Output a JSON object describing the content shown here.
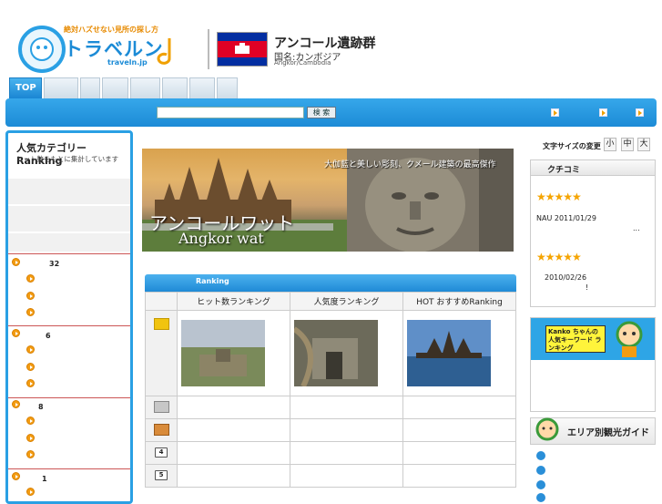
{
  "header": {
    "logo_tagline": "絶対ハズせない見所の探し方",
    "logo_name": "トラベルン",
    "logo_domain": "traveln.jp",
    "title": "アンコール遺跡群",
    "country": "国名:カンボジア",
    "title_en": "Angkor/Cambodia"
  },
  "tabs": [
    "TOP"
  ],
  "search": {
    "button": "検 索",
    "value": ""
  },
  "sidebar": {
    "title": "人気カテゴリーRanking",
    "subtitle": "ヒット数をもとに集計しています",
    "counts": [
      "32",
      "6",
      "8",
      "1"
    ]
  },
  "banner": {
    "title_jp": "アンコールワット",
    "title_en": "Angkor wat",
    "tagline": "大伽藍と美しい彫刻、クメール建築の最高傑作"
  },
  "ranking": {
    "header": "Ranking",
    "columns": [
      "ヒット数ランキング",
      "人気度ランキング",
      "HOT おすすめRanking"
    ],
    "rows": [
      "1",
      "2",
      "3",
      "4",
      "5"
    ]
  },
  "right": {
    "font_size_label": "文字サイズの変更",
    "font_sizes": [
      "小",
      "中",
      "大"
    ],
    "reviews_title": "クチコミ",
    "reviews": [
      {
        "stars": "★★★★★",
        "meta": "NAU 2011/01/29",
        "text": "..."
      },
      {
        "stars": "★★★★★",
        "meta": "2010/02/26",
        "text": "!"
      }
    ],
    "kanko_text": "Kanko ちゃんの 人気キーワード ランキング",
    "area_guide": "エリア別観光ガイド",
    "area_numbers": [
      "1",
      "2",
      "3"
    ]
  },
  "colors": {
    "accent": "#1c8bd6",
    "star": "#f5a400",
    "bullet": "#f39c12"
  }
}
